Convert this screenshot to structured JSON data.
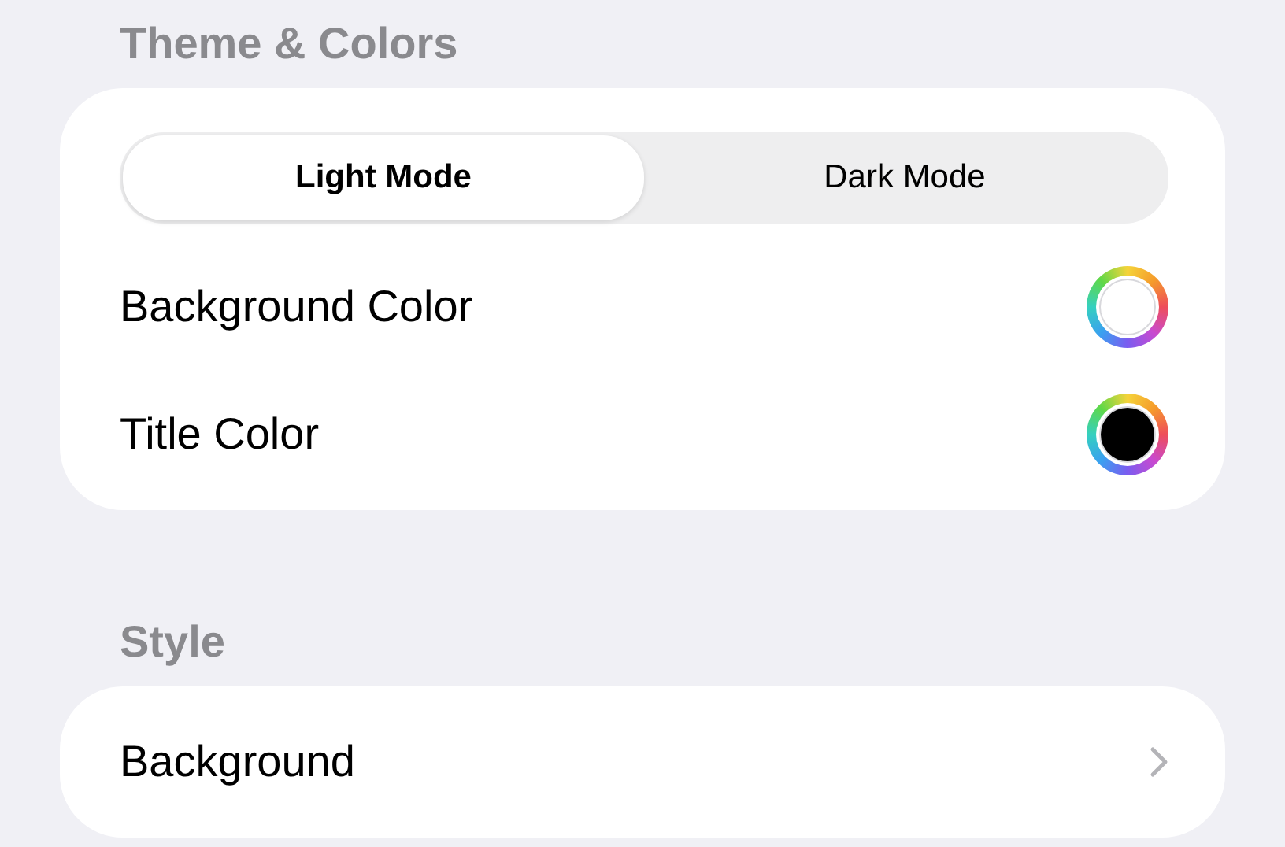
{
  "sections": [
    {
      "header": "Theme & Colors",
      "kind": "theme",
      "segments": [
        {
          "label": "Light Mode",
          "selected": true
        },
        {
          "label": "Dark Mode",
          "selected": false
        }
      ],
      "rows": [
        {
          "label": "Background Color",
          "color": "#ffffff"
        },
        {
          "label": "Title Color",
          "color": "#000000"
        }
      ]
    },
    {
      "header": "Style",
      "kind": "nav",
      "rows": [
        {
          "label": "Background"
        }
      ]
    }
  ]
}
